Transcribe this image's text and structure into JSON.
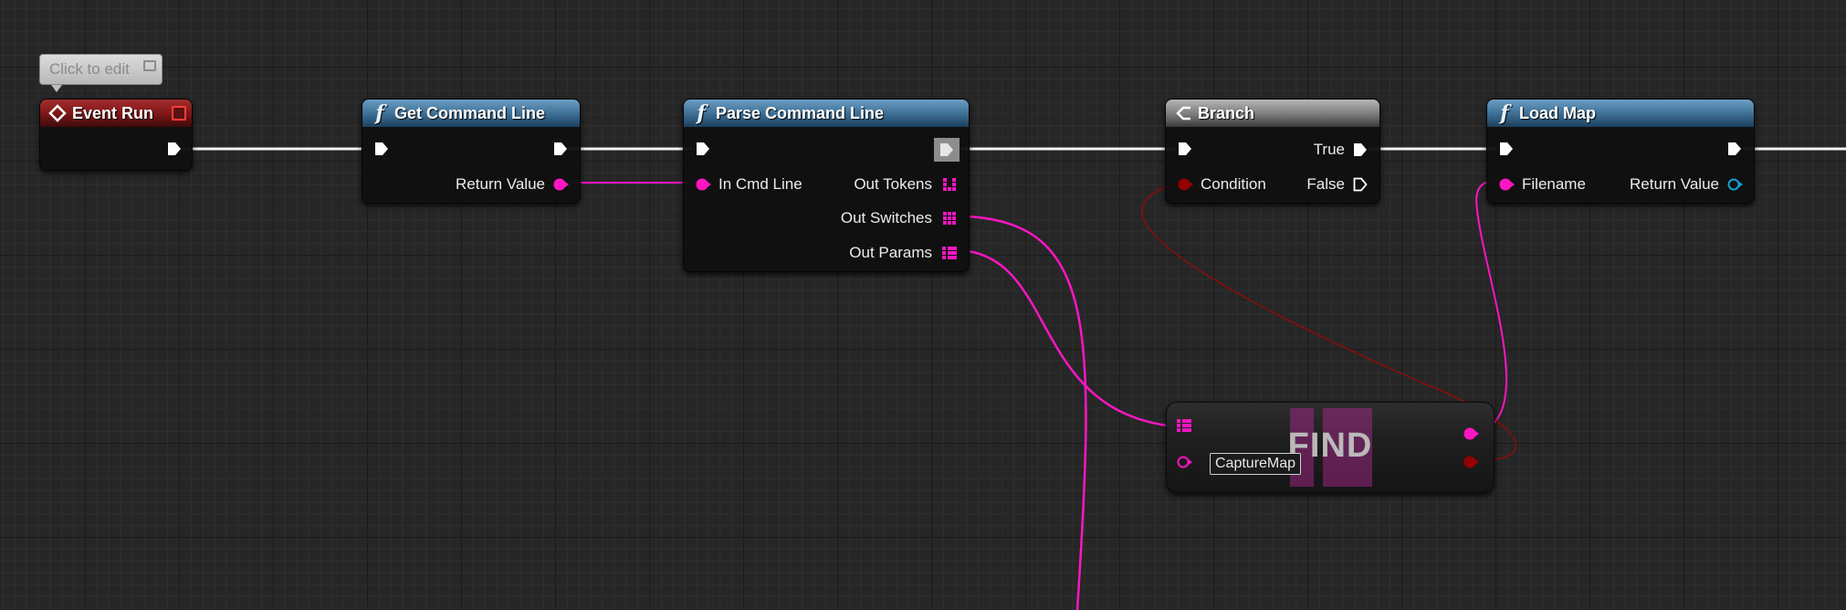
{
  "comment": {
    "text": "Click to edit"
  },
  "nodes": {
    "event_run": {
      "title": "Event Run"
    },
    "get_command_line": {
      "title": "Get Command Line",
      "out_return": "Return Value"
    },
    "parse_command_line": {
      "title": "Parse Command Line",
      "in_cmd_line": "In Cmd Line",
      "out_tokens": "Out Tokens",
      "out_switches": "Out Switches",
      "out_params": "Out Params"
    },
    "branch": {
      "title": "Branch",
      "condition": "Condition",
      "true_label": "True",
      "false_label": "False"
    },
    "load_map": {
      "title": "Load Map",
      "filename": "Filename",
      "return_value": "Return Value"
    },
    "find": {
      "title": "FIND",
      "key_value": "CaptureMap"
    }
  },
  "colors": {
    "exec": "#ffffff",
    "string_pin": "#fb16c3",
    "bool_pin": "#940000",
    "object_pin": "#14a0d6",
    "event_header": "#8a1c1c",
    "function_header": "#3b6c92"
  },
  "icons": {
    "event": "event-diamond-icon",
    "function": "function-f-icon",
    "branch": "branch-icon"
  }
}
